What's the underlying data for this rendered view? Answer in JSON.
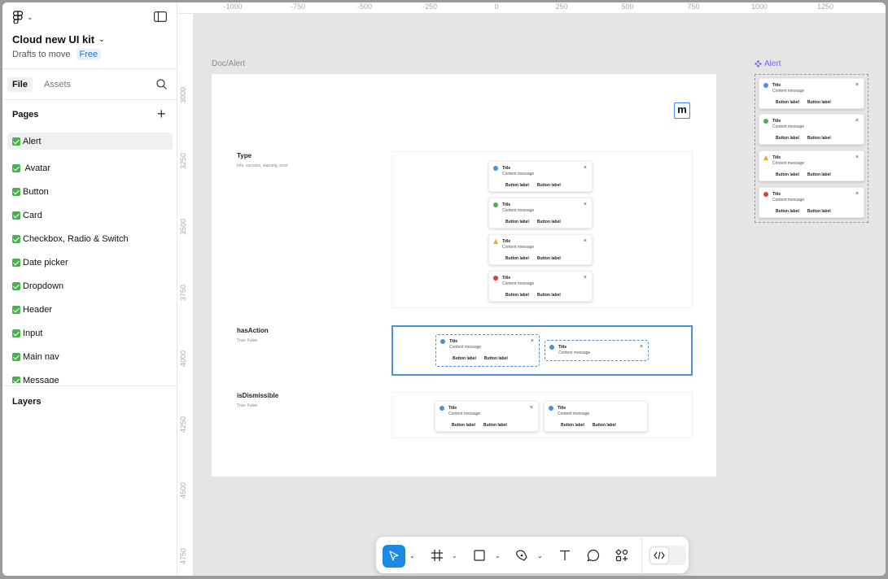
{
  "sidebar": {
    "file_name": "Cloud new UI kit",
    "location": "Drafts to move",
    "plan_badge": "Free",
    "tabs": {
      "file": "File",
      "assets": "Assets"
    },
    "pages_header": "Pages",
    "pages": [
      {
        "label": "Alert",
        "active": true
      },
      {
        "label": " Avatar"
      },
      {
        "label": "Button"
      },
      {
        "label": "Card"
      },
      {
        "label": "Checkbox, Radio & Switch"
      },
      {
        "label": "Date picker"
      },
      {
        "label": "Dropdown"
      },
      {
        "label": "Header"
      },
      {
        "label": "Input"
      },
      {
        "label": "Main nav"
      },
      {
        "label": "Message"
      }
    ],
    "layers_header": "Layers"
  },
  "rulers": {
    "top": [
      "-1000",
      "-750",
      "-500",
      "-250",
      "0",
      "250",
      "500",
      "750",
      "1000",
      "1250"
    ],
    "left": [
      "3000",
      "3250",
      "3500",
      "3750",
      "4000",
      "4250",
      "4500",
      "4750"
    ]
  },
  "canvas": {
    "frame_label": "Doc/Alert",
    "logo_letter": "m",
    "component_label": "Alert",
    "sections": [
      {
        "title": "Type",
        "desc": "Info, success, warning, error"
      },
      {
        "title": "hasAction",
        "desc": "True, False"
      },
      {
        "title": "isDismissible",
        "desc": "True, False"
      }
    ],
    "alert": {
      "title": "Title",
      "message": "Content message",
      "button": "Button label",
      "close": "×"
    }
  },
  "colors": {
    "info": "#4a90e2",
    "success": "#4caf50",
    "warning": "#f5a623",
    "error": "#e53935",
    "selection": "#4a90e2",
    "component": "#7b61ff"
  }
}
